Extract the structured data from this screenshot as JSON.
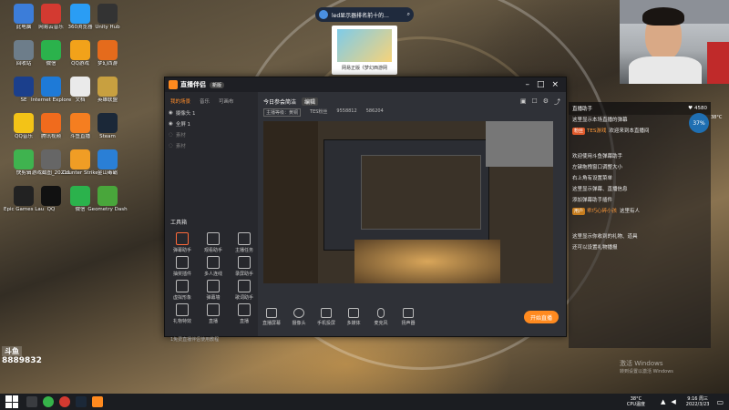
{
  "browser": {
    "search_text": "led显示器排名前十的..."
  },
  "ad": {
    "caption": "网易正版《梦幻西游网"
  },
  "desktop_icons": [
    {
      "label": "此电脑",
      "color": "#3c7dd9"
    },
    {
      "label": "网易云音乐",
      "color": "#d33a31"
    },
    {
      "label": "360浏览器",
      "color": "#2a9df4"
    },
    {
      "label": "Unity Hub",
      "color": "#333"
    },
    {
      "label": "回收站",
      "color": "#6d7d8a"
    },
    {
      "label": "微信",
      "color": "#2bb24c"
    },
    {
      "label": "QQ游戏",
      "color": "#f2a21a"
    },
    {
      "label": "梦幻西游",
      "color": "#e56b1c"
    },
    {
      "label": "SE",
      "color": "#1b3f8c"
    },
    {
      "label": "Internet Explorer",
      "color": "#1e7ad7"
    },
    {
      "label": "文档",
      "color": "#eaeaea"
    },
    {
      "label": "英雄联盟",
      "color": "#c8a040"
    },
    {
      "label": "QQ音乐",
      "color": "#f3c317"
    },
    {
      "label": "腾讯视频",
      "color": "#f06b1d"
    },
    {
      "label": "斗鱼直播",
      "color": "#f57e20"
    },
    {
      "label": "Steam",
      "color": "#1b2838"
    },
    {
      "label": "快剪辑",
      "color": "#3fb34f"
    },
    {
      "label": "游戏截图_20211",
      "color": "#666"
    },
    {
      "label": "Counter Strike",
      "color": "#f09d25"
    },
    {
      "label": "金山毒霸",
      "color": "#2a7fd6"
    },
    {
      "label": "Epic Games Launcher",
      "color": "#222"
    },
    {
      "label": "QQ",
      "color": "#111"
    },
    {
      "label": "微信",
      "color": "#2bb24c"
    },
    {
      "label": "Geometry Dash",
      "color": "#49a63b"
    }
  ],
  "webcam": {
    "label": "webcam-feed"
  },
  "app": {
    "title": "直播伴侣",
    "badge": "新版",
    "left_tabs": [
      "我的场景",
      "音乐",
      "可画布"
    ],
    "scenes": [
      "摄像头 1",
      "全屏 1",
      "素材",
      "素材"
    ],
    "section_title": "工具箱",
    "tools": [
      "弹幕助手",
      "观看助手",
      "主播任务",
      "抽奖插件",
      "多人连线",
      "录屏助手",
      "虚拟形象",
      "弹幕墙",
      "歌词助手",
      "礼物特效",
      "直播",
      "直播"
    ],
    "header": {
      "title": "今日参会简洁",
      "tag": "编辑",
      "stat1": "主播等级：黄铜",
      "stat2": "TES粉丝",
      "stat3": "9558812",
      "stat4": "586204"
    },
    "bottom_buttons": [
      "直播屏幕",
      "摄像头",
      "手机投屏",
      "多媒体",
      "麦克风",
      "扬声器"
    ],
    "start_button": "开始直播",
    "footer": "1免费直播伴侣使用教程"
  },
  "chat": {
    "header_left": "直播助手",
    "header_count": "4580",
    "cpu": "37%",
    "cpu_temp": "38°C",
    "messages": [
      {
        "tag": "",
        "user": "",
        "text": "这里显示本场直播的弹幕"
      },
      {
        "tag": "粉丝",
        "user": "TES游戏",
        "text": "欢迎来到本直播间"
      },
      {
        "tag": "",
        "user": "",
        "text": "欢迎使用斗鱼弹幕助手"
      },
      {
        "tag": "",
        "user": "",
        "text": "左键拖拽窗口调整大小"
      },
      {
        "tag": "",
        "user": "",
        "text": "右上角有设置菜单"
      },
      {
        "tag": "",
        "user": "",
        "text": "这里显示弹幕、直播信息"
      },
      {
        "tag": "",
        "user": "",
        "text": "添加弹幕助手插件"
      },
      {
        "tag": "用户",
        "user": "乖巧心碎小孩",
        "text": "这里有人"
      },
      {
        "tag": "",
        "user": "",
        "text": "这里显示你收到的礼物、道具"
      },
      {
        "tag": "",
        "user": "",
        "text": "还可以设置礼物播报"
      }
    ]
  },
  "watermark": {
    "id": "8889832"
  },
  "system": {
    "activate_title": "激活 Windows",
    "activate_sub": "转到设置以激活 Windows",
    "tray_temp": "38°C",
    "tray_label": "CPU温度",
    "time": "9:16 周三",
    "date": "2022/3/23"
  }
}
